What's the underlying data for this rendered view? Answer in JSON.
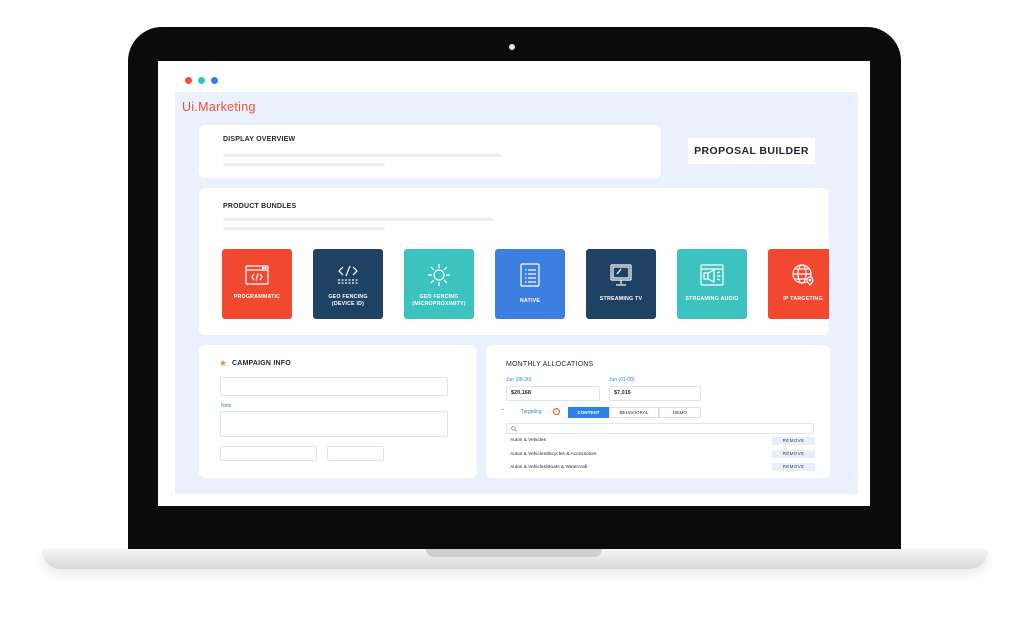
{
  "window": {
    "dots": [
      "#f04e37",
      "#2ec4b6",
      "#2f7fe8"
    ]
  },
  "app": {
    "logo": "Ui.Marketing"
  },
  "overview": {
    "title": "DISPLAY OVERVIEW"
  },
  "proposal": {
    "label": "PROPOSAL BUILDER"
  },
  "bundles": {
    "title": "PRODUCT BUNDLES",
    "items": [
      {
        "label": "PROGRAMMATIC",
        "color": "#f1492f",
        "icon": "code-window-icon"
      },
      {
        "label": "GEO FENCING\n(DEVICE ID)",
        "color": "#1f4163",
        "icon": "code-brackets-icon"
      },
      {
        "label": "GEO FENCING\n(MICROPROXIMITY)",
        "color": "#3cc3bf",
        "icon": "sun-burst-icon"
      },
      {
        "label": "NATIVE",
        "color": "#3d7fe0",
        "icon": "list-document-icon"
      },
      {
        "label": "STREAMING TV",
        "color": "#1f4163",
        "icon": "television-icon"
      },
      {
        "label": "STREAMING AUDIO",
        "color": "#3cc3bf",
        "icon": "speaker-icon"
      },
      {
        "label": "IP TARGETING",
        "color": "#f1492f",
        "icon": "globe-pin-icon"
      }
    ]
  },
  "campaign": {
    "title": "CAMPAIGN INFO",
    "note_label": "Note"
  },
  "monthly": {
    "title": "MONTHLY ALLOCATIONS",
    "allocations": [
      {
        "label": "Jun (08-30)",
        "value": "$20,168"
      },
      {
        "label": "Jun (01-08)",
        "value": "$7,015"
      }
    ],
    "targeting_label": "Targeting",
    "tabs": [
      "CONTENT",
      "BEHAVIORAL",
      "DEMO"
    ],
    "active_tab": "CONTENT",
    "rows": [
      {
        "label": "Autos & Vehicles",
        "action": "REMOVE"
      },
      {
        "label": "Autos & Vehicles/Bicycles & Accessories",
        "action": "REMOVE"
      },
      {
        "label": "Autos & Vehicles/Boats & Watercraft",
        "action": "REMOVE"
      }
    ]
  }
}
